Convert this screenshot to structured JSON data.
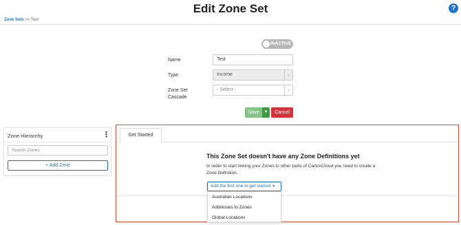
{
  "header": {
    "title": "Edit Zone Set",
    "help_icon": "?"
  },
  "breadcrumb": {
    "link": "Zone Sets",
    "separator": ">>",
    "current": "Test"
  },
  "status": {
    "label": "INACTIVE"
  },
  "form": {
    "name_label": "Name",
    "name_value": "Test",
    "type_label": "Type",
    "type_value": "Income",
    "cascade_label_line1": "Zone Set",
    "cascade_label_line2": "Cascade",
    "cascade_value": "- Select -",
    "chevron_icon": "chevron-down-icon"
  },
  "actions": {
    "save_label": "Save",
    "cancel_label": "Cancel",
    "save_colors": {
      "primary": "#86c488",
      "caret": "#3e9b44"
    },
    "cancel_color": "#d6323a"
  },
  "sidebar": {
    "title": "Zone Hierarchy",
    "search_placeholder": "Search Zones",
    "add_zone_label": "+ Add Zone"
  },
  "main": {
    "tabs": [
      {
        "label": "Get Started"
      }
    ],
    "empty_state": {
      "title": "This Zone Set doesn't have any Zone Definitions yet",
      "description": "In order to start linking your Zones to other parts of CartonCloud you need to create a Zone Definition.",
      "button_label": "Add the first one to get started",
      "menu_items": [
        {
          "label": "Australian Locations"
        },
        {
          "label": "Addresses to Zones"
        },
        {
          "label": "Global Locations"
        }
      ]
    }
  },
  "theme": {
    "accent": "#1a73c8",
    "highlight_border": "#e2483a"
  }
}
